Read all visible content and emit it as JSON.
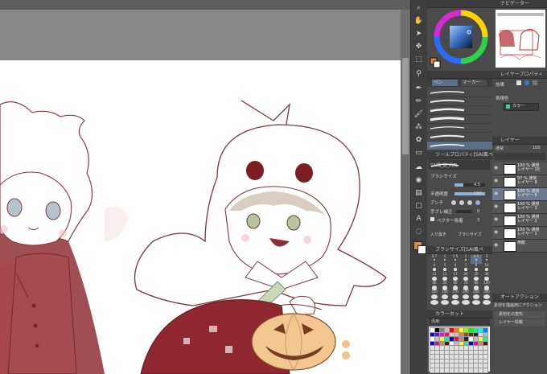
{
  "subtool": {
    "tab_pen": "ペン",
    "tab_marker": "マーカー"
  },
  "navigator": {
    "title": "ナビゲーター"
  },
  "layer_property": {
    "title": "レイヤープロパティ",
    "effect": "効果",
    "expression_color": "表現色",
    "color_value": "カラー"
  },
  "tool_property": {
    "title": "ツールプロパティ[SAI風ペン]",
    "brush_name": "SAI風_黒_汎用",
    "brush_size_label": "ブラシサイズ",
    "opacity_label": "不透明度",
    "brush_size_value": "4.5",
    "opacity_value": "100",
    "stabilization_value": "0",
    "vector_value": "3",
    "anti_alias_label": "アンチ",
    "stabilization_label": "手ブレ補正",
    "vector_label": "ベクター吸着",
    "brush_size_btn": "ブラシサイズ",
    "in_out_btn": "入り抜き"
  },
  "brush_size": {
    "title": "ブラシサイズ[SAI風ペ",
    "sizes": [
      "0.7",
      "1",
      "1.5",
      "2",
      "2.5",
      "3",
      "4",
      "5",
      "6",
      "7",
      "8",
      "10",
      "12",
      "15",
      "17",
      "20",
      "25",
      "30",
      "40",
      "50",
      "60",
      "70",
      "80",
      "100",
      "120",
      "150",
      "170",
      "200",
      "250",
      "300",
      "",
      "",
      "",
      "",
      "",
      ""
    ]
  },
  "color_set": {
    "title": "カラーセット",
    "set_name": "汎用"
  },
  "layer": {
    "title": "レイヤー",
    "blend_mode": "通常",
    "opacity": "100",
    "rows": [
      {
        "name": "100 % 通常\nレイヤー 10"
      },
      {
        "name": "97 % 通常\nレイヤー 8"
      },
      {
        "name": "100 % 通常\nレイヤー 6"
      },
      {
        "name": "100 % 通常\nレイヤー 3"
      },
      {
        "name": "100 % 通常\nレイヤー 2"
      },
      {
        "name": "100 % 通常\nレイヤー 1"
      },
      {
        "name": "用紙"
      }
    ]
  },
  "auto_action": {
    "title": "オートアクション",
    "set_name": "素材を描画用にアクション",
    "items": [
      "素材をの変形",
      "レイヤー情報"
    ]
  },
  "colors": {
    "main": "#d98b3f"
  }
}
